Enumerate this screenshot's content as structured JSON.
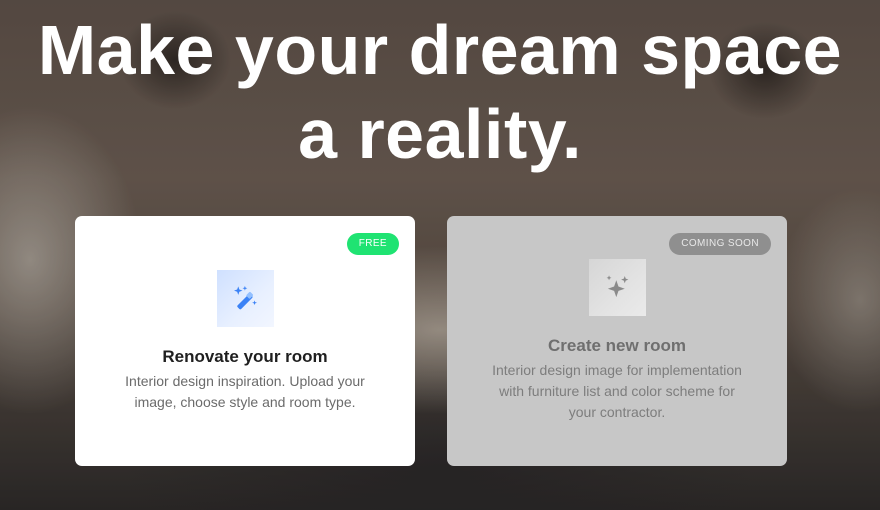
{
  "headline": {
    "line1": "Make your dream space",
    "line2": "a reality."
  },
  "cards": [
    {
      "title": "Renovate your room",
      "description": "Interior design inspiration. Upload your image, choose style and room type.",
      "badge": "FREE",
      "icon": "magic-wand-icon",
      "badge_color": "#1fe372"
    },
    {
      "title": "Create new room",
      "description": "Interior design image for implementation with furniture list and color scheme for your contractor.",
      "badge": "COMING SOON",
      "icon": "sparkles-icon",
      "badge_color": "#8f8f8f"
    }
  ]
}
